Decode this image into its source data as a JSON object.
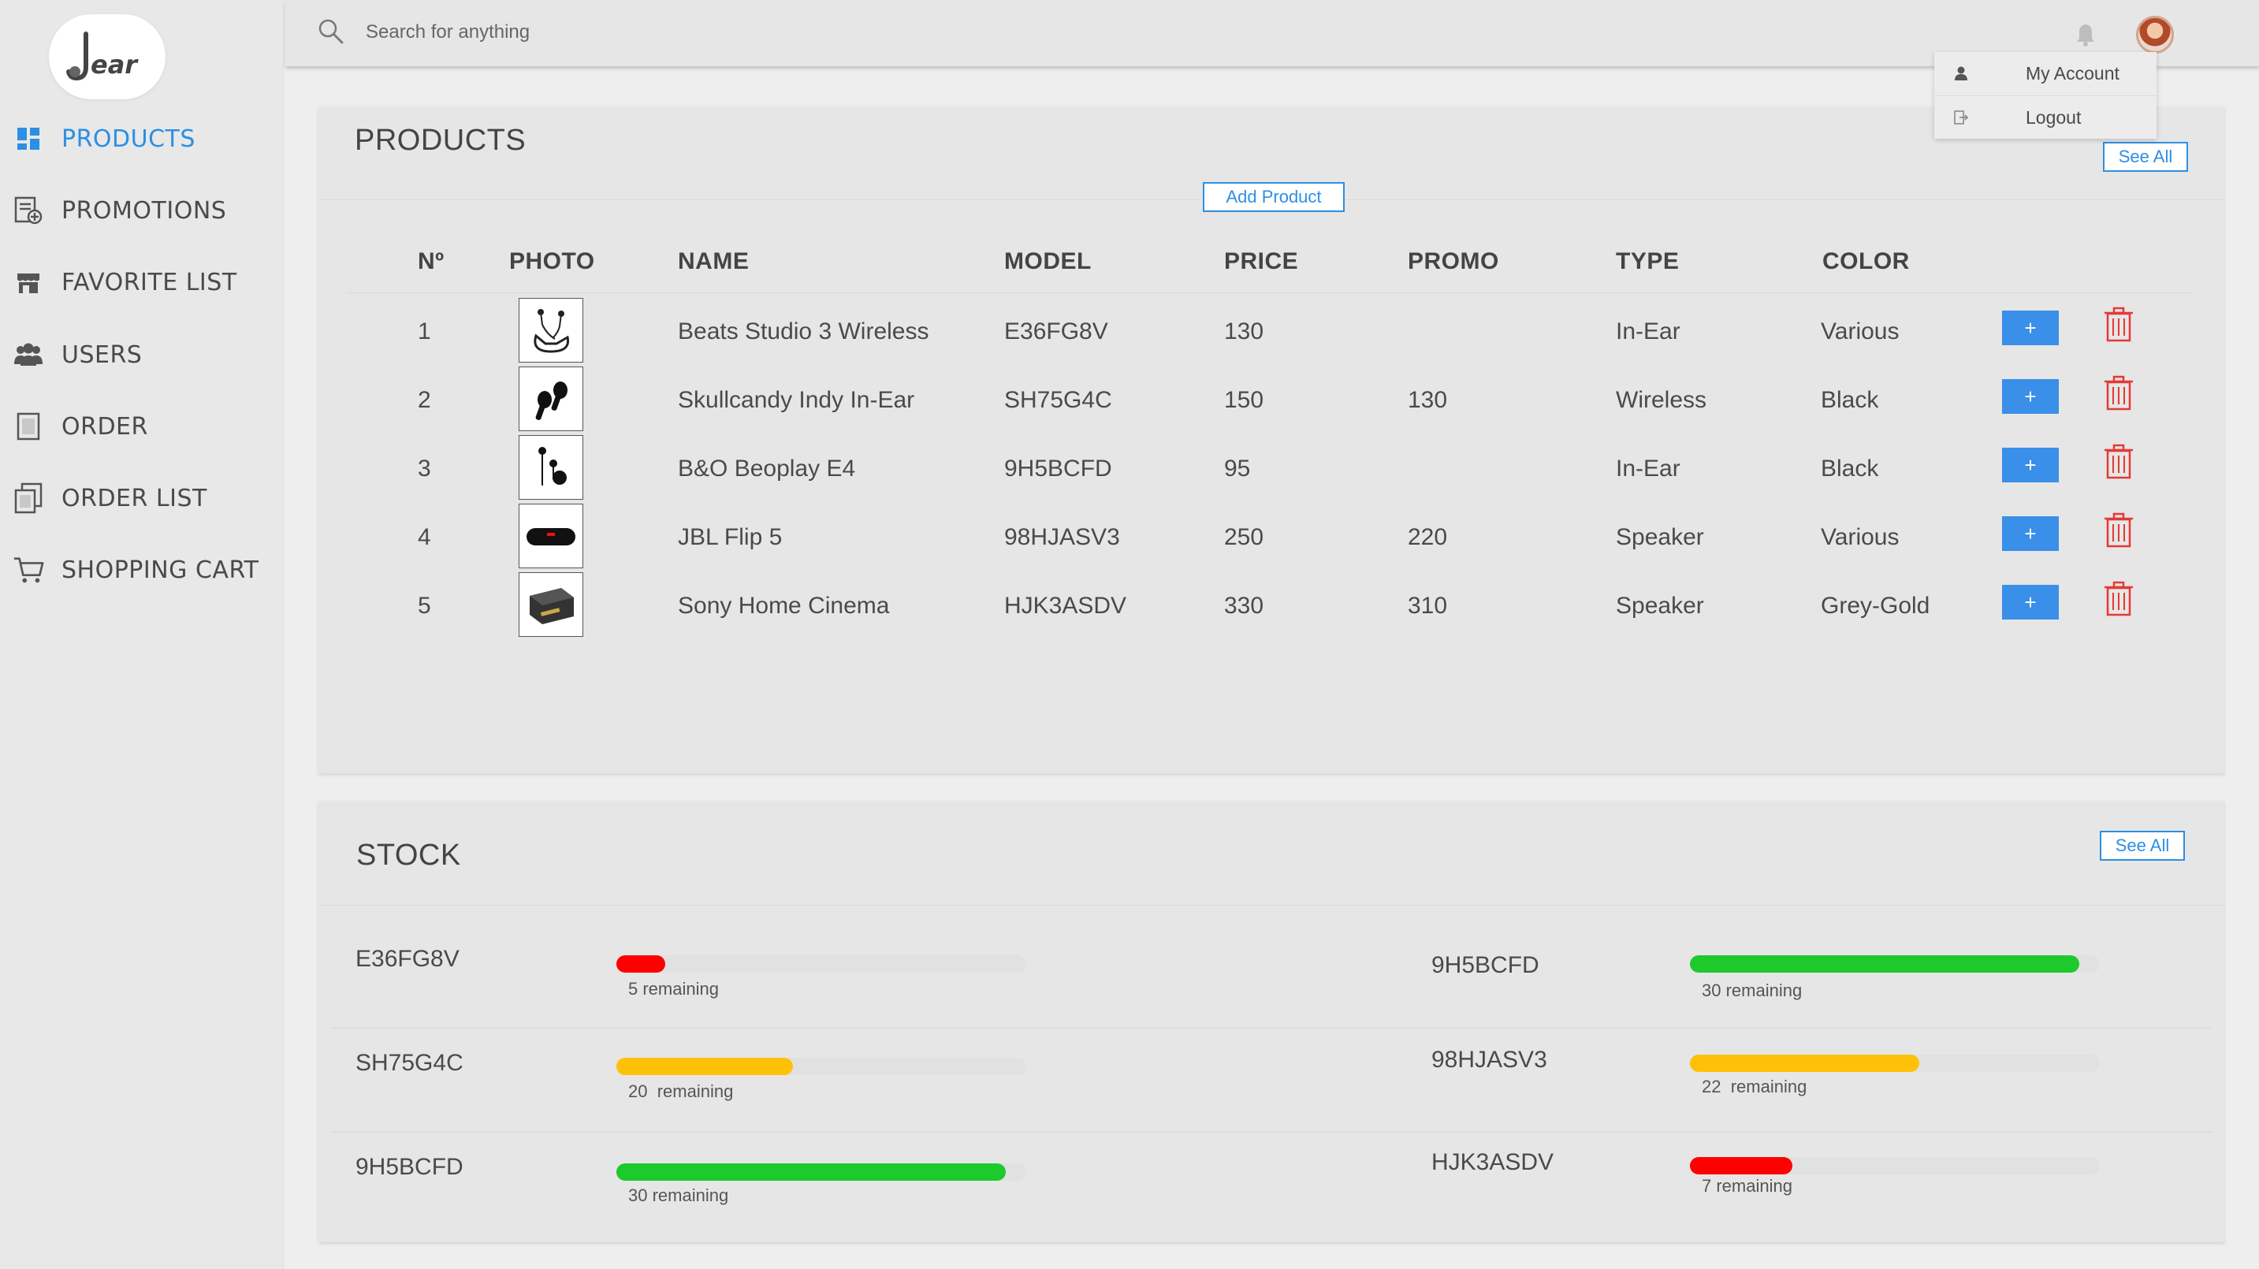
{
  "brand": {
    "logo_initial": "J",
    "logo_rest": "ear"
  },
  "nav": {
    "items": [
      {
        "label": "PRODUCTS",
        "icon": "dashboard-icon",
        "active": true
      },
      {
        "label": "PROMOTIONS",
        "icon": "promotion-icon",
        "active": false
      },
      {
        "label": "FAVORITE LIST",
        "icon": "store-icon",
        "active": false
      },
      {
        "label": "USERS",
        "icon": "users-icon",
        "active": false
      },
      {
        "label": "ORDER",
        "icon": "order-icon",
        "active": false
      },
      {
        "label": "ORDER LIST",
        "icon": "order-list-icon",
        "active": false
      },
      {
        "label": "SHOPPING CART",
        "icon": "cart-icon",
        "active": false
      }
    ]
  },
  "search": {
    "placeholder": "Search for anything"
  },
  "account_menu": {
    "my_account": "My Account",
    "logout": "Logout"
  },
  "products": {
    "title": "PRODUCTS",
    "see_all": "See All",
    "add_product": "Add Product",
    "columns": [
      "Nº",
      "PHOTO",
      "NAME",
      "MODEL",
      "PRICE",
      "PROMO",
      "TYPE",
      "COLOR"
    ],
    "rows": [
      {
        "n": "1",
        "name": "Beats Studio 3 Wireless",
        "model": "E36FG8V",
        "price": "130",
        "promo": "",
        "type": "In-Ear",
        "color": "Various",
        "photo": "neckband-earphones-icon",
        "add_label": "+"
      },
      {
        "n": "2",
        "name": "Skullcandy Indy In-Ear",
        "model": "SH75G4C",
        "price": "150",
        "promo": "130",
        "type": "Wireless",
        "color": "Black",
        "photo": "wireless-earbuds-icon",
        "add_label": "+"
      },
      {
        "n": "3",
        "name": "B&O Beoplay E4",
        "model": "9H5BCFD",
        "price": "95",
        "promo": "",
        "type": "In-Ear",
        "color": "Black",
        "photo": "wired-earphones-icon",
        "add_label": "+"
      },
      {
        "n": "4",
        "name": "JBL Flip 5",
        "model": "98HJASV3",
        "price": "250",
        "promo": "220",
        "type": "Speaker",
        "color": "Various",
        "photo": "portable-speaker-icon",
        "add_label": "+"
      },
      {
        "n": "5",
        "name": "Sony Home Cinema",
        "model": "HJK3ASDV",
        "price": "330",
        "promo": "310",
        "type": "Speaker",
        "color": "Grey-Gold",
        "photo": "home-speaker-icon",
        "add_label": "+"
      }
    ]
  },
  "stock": {
    "title": "STOCK",
    "see_all": "See All",
    "items": [
      {
        "model": "E36FG8V",
        "remaining": 5,
        "label": "5 remaining",
        "level": 0.12,
        "color": "#ff0000"
      },
      {
        "model": "9H5BCFD",
        "remaining": 30,
        "label": "30 remaining",
        "level": 0.95,
        "color": "#1ec92c"
      },
      {
        "model": "SH75G4C",
        "remaining": 20,
        "label": "20  remaining",
        "level": 0.43,
        "color": "#ffc107"
      },
      {
        "model": "98HJASV3",
        "remaining": 22,
        "label": "22  remaining",
        "level": 0.56,
        "color": "#ffc107"
      },
      {
        "model": "9H5BCFD",
        "remaining": 30,
        "label": "30 remaining",
        "level": 0.95,
        "color": "#1ec92c"
      },
      {
        "model": "HJK3ASDV",
        "remaining": 7,
        "label": "7 remaining",
        "level": 0.25,
        "color": "#ff0000"
      }
    ]
  },
  "colors": {
    "accent": "#2d8fe3",
    "button": "#3a8fe8",
    "danger": "#e53935"
  }
}
